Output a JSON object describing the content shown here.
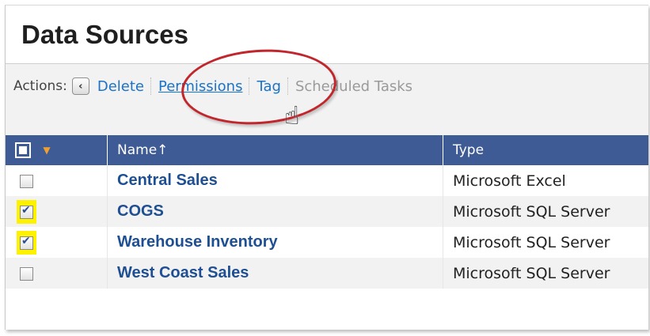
{
  "page": {
    "title": "Data Sources"
  },
  "actions": {
    "label": "Actions:",
    "back_icon": "‹",
    "items": [
      {
        "label": "Delete",
        "state": "enabled"
      },
      {
        "label": "Permissions",
        "state": "hover"
      },
      {
        "label": "Tag",
        "state": "enabled"
      },
      {
        "label": "Scheduled Tasks",
        "state": "disabled"
      }
    ]
  },
  "colors": {
    "header_bg": "#3f5b95",
    "link": "#1a73c6",
    "row_name": "#1d4f92",
    "highlight": "#fff200",
    "annotation": "#c0262b"
  },
  "table": {
    "columns": [
      {
        "key": "select",
        "label": ""
      },
      {
        "key": "name",
        "label": "Name",
        "sort_indicator": "↑"
      },
      {
        "key": "type",
        "label": "Type"
      }
    ],
    "header_menu_icon": "▼",
    "rows": [
      {
        "name": "Central Sales",
        "type": "Microsoft Excel",
        "checked": false
      },
      {
        "name": "COGS",
        "type": "Microsoft SQL Server",
        "checked": true
      },
      {
        "name": "Warehouse Inventory",
        "type": "Microsoft SQL Server",
        "checked": true
      },
      {
        "name": "West Coast Sales",
        "type": "Microsoft SQL Server",
        "checked": false
      }
    ]
  },
  "cursor": {
    "icon": "hand-pointer-icon",
    "glyph": "☝"
  }
}
